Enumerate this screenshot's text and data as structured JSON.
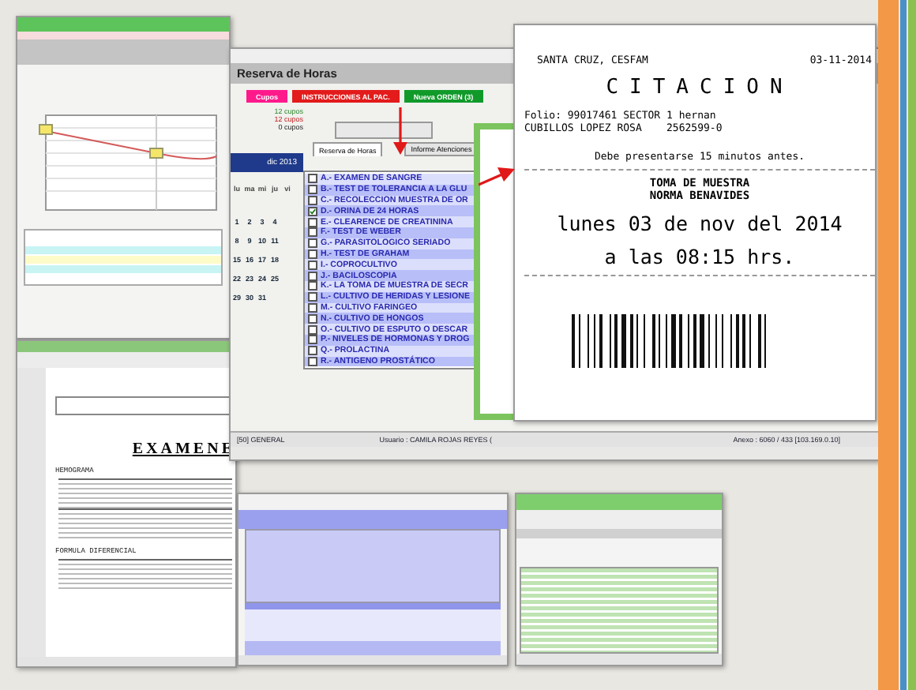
{
  "history_window": {
    "rows": [
      {
        "color": "#c8f4f4"
      },
      {
        "color": "#fdfbc8"
      },
      {
        "color": "#c8f4f4"
      }
    ]
  },
  "report_window": {
    "heading": "EXAMENE",
    "sections": [
      "HEMOGRAMA",
      "FORMULA DIFERENCIAL"
    ]
  },
  "booking_window": {
    "title": "Reserva de Horas",
    "buttons": [
      {
        "label": "Cupos",
        "color": "#ff1a8c"
      },
      {
        "label": "INSTRUCCIONES AL PAC.",
        "color": "#e31b1b"
      },
      {
        "label": "Nueva ORDEN (3)",
        "color": "#109a2a"
      }
    ],
    "quotas": [
      "12 cupos",
      "12 cupos",
      "0 cupos"
    ],
    "tabs": [
      {
        "label": "Reserva de Horas",
        "selected": true
      },
      {
        "label": "Informe Atenciones",
        "selected": false
      }
    ],
    "calendar": {
      "month": "dic 2013",
      "weekdays": [
        "lu",
        "ma",
        "mi",
        "ju",
        "vi"
      ],
      "weeks": [
        [
          "1",
          "2",
          "3",
          "4"
        ],
        [
          "8",
          "9",
          "10",
          "11"
        ],
        [
          "15",
          "16",
          "17",
          "18"
        ],
        [
          "22",
          "23",
          "24",
          "25"
        ],
        [
          "29",
          "30",
          "31"
        ]
      ]
    },
    "exams": [
      {
        "label": "A.- EXAMEN DE SANGRE",
        "checked": false
      },
      {
        "label": "B.- TEST DE TOLERANCIA A LA GLU",
        "checked": false
      },
      {
        "label": "C.- RECOLECCION MUESTRA DE OR",
        "checked": false
      },
      {
        "label": "D.- ORINA DE 24 HORAS",
        "checked": true
      },
      {
        "label": "E.- CLEARENCE DE CREATININA",
        "checked": false
      },
      {
        "label": "F.- TEST DE WEBER",
        "checked": false
      },
      {
        "label": "G.- PARASITOLOGICO SERIADO",
        "checked": false
      },
      {
        "label": "H.- TEST DE GRAHAM",
        "checked": false
      },
      {
        "label": "I.- COPROCULTIVO",
        "checked": false
      },
      {
        "label": "J.- BACILOSCOPIA",
        "checked": false
      },
      {
        "label": "K.- LA TOMA DE MUESTRA DE SECR",
        "checked": false
      },
      {
        "label": "L.- CULTIVO DE HERIDAS Y LESIONE",
        "checked": false
      },
      {
        "label": "M.- CULTIVO FARINGEO",
        "checked": false
      },
      {
        "label": "N.- CULTIVO DE HONGOS",
        "checked": false
      },
      {
        "label": "O.- CULTIVO DE ESPUTO O DESCAR",
        "checked": false
      },
      {
        "label": "P.- NIVELES DE HORMONAS Y DROG",
        "checked": false
      },
      {
        "label": "Q.- PROLACTINA",
        "checked": false
      },
      {
        "label": "R.- ANTIGENO PROSTÁTICO",
        "checked": false
      }
    ],
    "status_bar": {
      "box": "[50] GENERAL",
      "user": "Usuario : CAMILA ROJAS REYES (",
      "anexo": "Anexo : 6060 / 433 [103.169.0.10]"
    }
  },
  "receipt": {
    "place": "SANTA CRUZ, CESFAM",
    "date": "03-11-2014",
    "title": "CITACION",
    "folio": "Folio: 99017461  SECTOR 1  hernan",
    "patient": "CUBILLOS LOPEZ ROSA    2562599-0",
    "notice": "Debe presentarse 15 minutos antes.",
    "service": "TOMA DE MUESTRA",
    "staff": "NORMA BENAVIDES",
    "day": "lunes 03 de nov del 2014",
    "time": "a las 08:15 hrs."
  }
}
